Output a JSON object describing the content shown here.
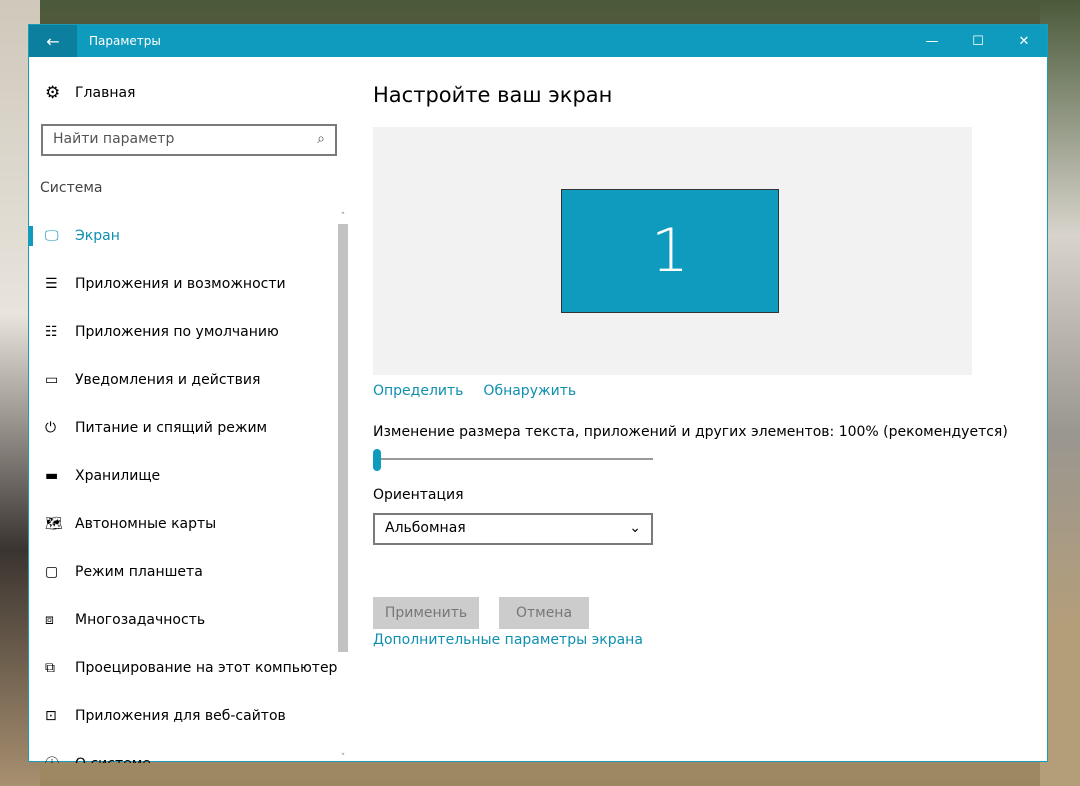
{
  "window": {
    "title": "Параметры",
    "back": "←",
    "minimize": "—",
    "maximize": "☐",
    "close": "✕"
  },
  "sidebar": {
    "home": "Главная",
    "search_placeholder": "Найти параметр",
    "section": "Система",
    "items": [
      {
        "label": "Экран",
        "icon": "🖵"
      },
      {
        "label": "Приложения и возможности",
        "icon": "☰"
      },
      {
        "label": "Приложения по умолчанию",
        "icon": "☷"
      },
      {
        "label": "Уведомления и действия",
        "icon": "▭"
      },
      {
        "label": "Питание и спящий режим",
        "icon": "⏻"
      },
      {
        "label": "Хранилище",
        "icon": "▬"
      },
      {
        "label": "Автономные карты",
        "icon": "🗺"
      },
      {
        "label": "Режим планшета",
        "icon": "▢"
      },
      {
        "label": "Многозадачность",
        "icon": "⧈"
      },
      {
        "label": "Проецирование на этот компьютер",
        "icon": "⧉"
      },
      {
        "label": "Приложения для веб-сайтов",
        "icon": "⊡"
      },
      {
        "label": "О системе",
        "icon": "ⓘ"
      }
    ],
    "selected": 0
  },
  "main": {
    "title": "Настройте ваш экран",
    "monitor_number": "1",
    "identify": "Определить",
    "detect": "Обнаружить",
    "scale_label": "Изменение размера текста, приложений и других элементов: 100% (рекомендуется)",
    "scale_value_percent": 100,
    "orientation_label": "Ориентация",
    "orientation_value": "Альбомная",
    "apply": "Применить",
    "cancel": "Отмена",
    "advanced": "Дополнительные параметры экрана"
  }
}
